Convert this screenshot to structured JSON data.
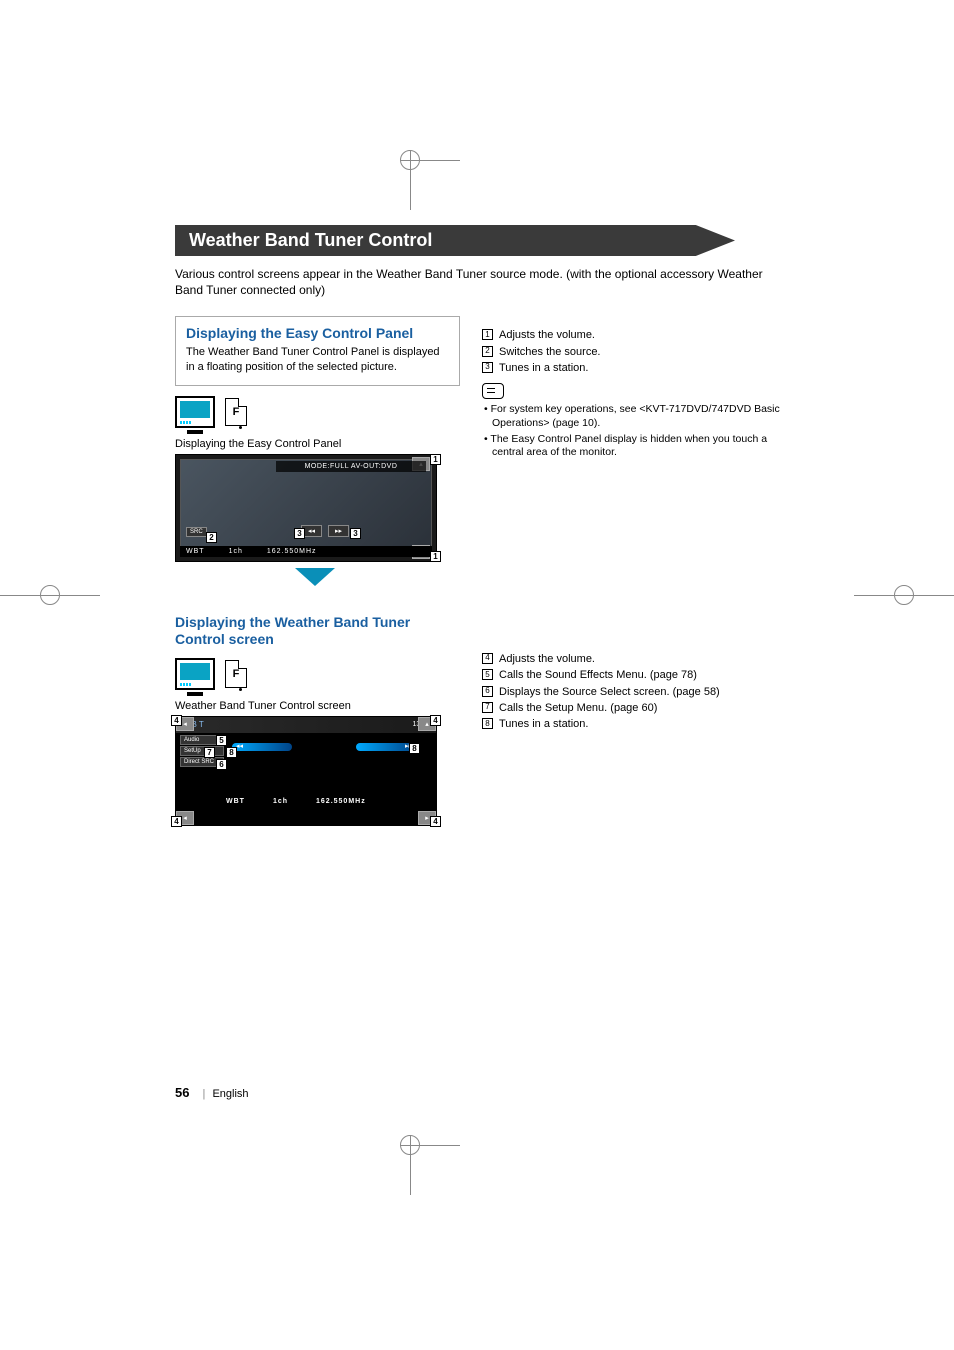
{
  "header": {
    "title": "Weather Band Tuner Control",
    "intro": "Various control screens appear in the Weather Band Tuner source mode. (with the optional accessory Weather Band Tuner connected only)"
  },
  "section1": {
    "title": "Displaying the Easy Control Panel",
    "desc": "The Weather Band Tuner Control Panel is displayed in a floating position of the selected picture.",
    "f_label": "F",
    "caption": "Displaying the Easy Control Panel",
    "screenshot": {
      "mode_text": "MODE:FULL  AV-OUT:DVD",
      "src": "SRC",
      "prev": "◂◂",
      "next": "▸▸",
      "band": "WBT",
      "ch": "1ch",
      "freq": "162.550MHz",
      "vol_up": "▴",
      "vol_dn": "▾"
    },
    "callouts": {
      "c1": "1",
      "c2": "2",
      "c3a": "3",
      "c3b": "3",
      "c1b": "1"
    },
    "right_list": [
      {
        "n": "1",
        "t": "Adjusts the volume."
      },
      {
        "n": "2",
        "t": "Switches the source."
      },
      {
        "n": "3",
        "t": "Tunes in a station."
      }
    ],
    "notes": [
      "For system key operations, see <KVT-717DVD/747DVD Basic Operations> (page 10).",
      "The Easy Control Panel display is hidden when you touch a central area of the monitor."
    ]
  },
  "section2": {
    "title": "Displaying the Weather Band Tuner Control screen",
    "f_label": "F",
    "caption": "Weather Band Tuner Control screen",
    "screenshot": {
      "label": "WBT",
      "time": "13:50",
      "btn_audio": "Audio",
      "btn_setup": "SetUp",
      "btn_direct": "Direct SRC",
      "prev": "◂◂",
      "next": "▸▸",
      "band": "WBT",
      "ch": "1ch",
      "freq": "162.550MHz"
    },
    "callouts": {
      "c4a": "4",
      "c4b": "4",
      "c4c": "4",
      "c4d": "4",
      "c5": "5",
      "c6": "6",
      "c7": "7",
      "c8a": "8",
      "c8b": "8"
    },
    "right_list": [
      {
        "n": "4",
        "t": "Adjusts the volume."
      },
      {
        "n": "5",
        "t": "Calls the Sound Effects Menu. (page 78)"
      },
      {
        "n": "6",
        "t": "Displays the Source Select screen. (page 58)"
      },
      {
        "n": "7",
        "t": "Calls the Setup Menu. (page 60)"
      },
      {
        "n": "8",
        "t": "Tunes in a station."
      }
    ]
  },
  "footer": {
    "page": "56",
    "lang": "English"
  }
}
